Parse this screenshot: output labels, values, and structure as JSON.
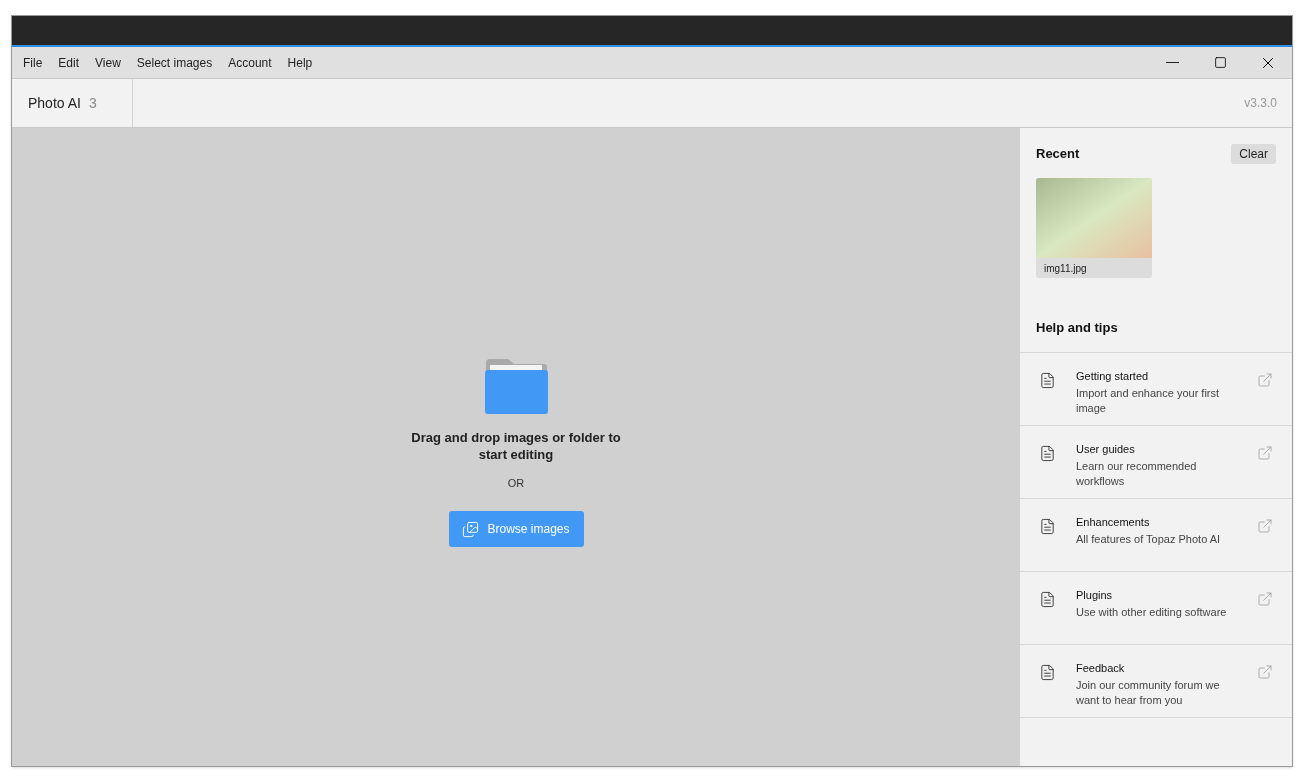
{
  "menu": [
    "File",
    "Edit",
    "View",
    "Select images",
    "Account",
    "Help"
  ],
  "header": {
    "app_name": "Photo AI",
    "app_number": "3",
    "version": "v3.3.0"
  },
  "drop_zone": {
    "message": "Drag and drop images or folder to start editing",
    "separator": "OR",
    "button": "Browse images"
  },
  "recent": {
    "title": "Recent",
    "clear_button": "Clear",
    "items": [
      {
        "filename": "img11.jpg"
      }
    ]
  },
  "help": {
    "title": "Help and tips",
    "items": [
      {
        "title": "Getting started",
        "description": "Import and enhance your first image"
      },
      {
        "title": "User guides",
        "description": "Learn our recommended workflows"
      },
      {
        "title": "Enhancements",
        "description": "All features of Topaz Photo AI"
      },
      {
        "title": "Plugins",
        "description": "Use with other editing software"
      },
      {
        "title": "Feedback",
        "description": "Join our community forum we want to hear from you"
      }
    ]
  }
}
